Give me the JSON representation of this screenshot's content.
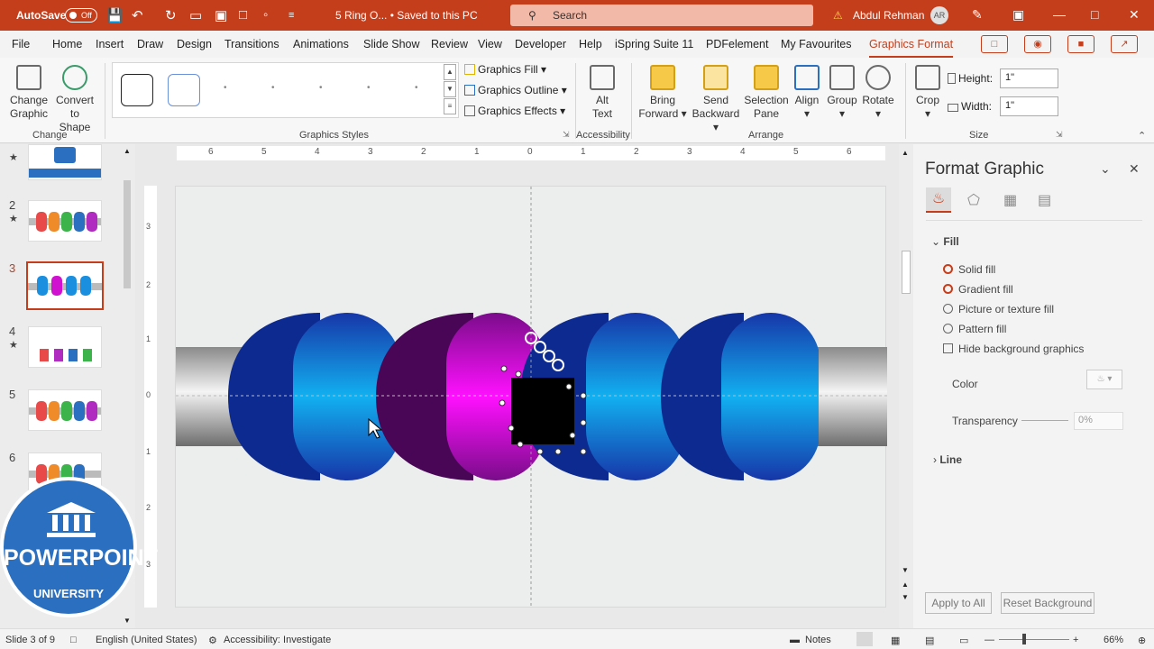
{
  "titlebar": {
    "autosave_label": "AutoSave",
    "autosave_state": "Off",
    "doc_title": "5 Ring O...  •  Saved to this PC",
    "search_placeholder": "Search",
    "user_name": "Abdul Rehman",
    "user_initials": "AR"
  },
  "menu": [
    "File",
    "Home",
    "Insert",
    "Draw",
    "Design",
    "Transitions",
    "Animations",
    "Slide Show",
    "Review",
    "View",
    "Developer",
    "Help",
    "iSpring Suite 11",
    "PDFelement",
    "My Favourites",
    "Graphics Format"
  ],
  "ribbon": {
    "change_graphic": "Change\nGraphic",
    "convert_to_shape": "Convert\nto Shape",
    "group_change": "Change",
    "graphics_fill": "Graphics Fill",
    "graphics_outline": "Graphics Outline",
    "graphics_effects": "Graphics Effects",
    "group_styles": "Graphics Styles",
    "alt_text": "Alt\nText",
    "group_accessibility": "Accessibility",
    "bring_forward": "Bring\nForward",
    "send_backward": "Send\nBackward",
    "selection_pane": "Selection\nPane",
    "align": "Align",
    "group_btn": "Group",
    "rotate": "Rotate",
    "group_arrange": "Arrange",
    "crop": "Crop",
    "height_label": "Height:",
    "height_value": "1\"",
    "width_label": "Width:",
    "width_value": "1\"",
    "group_size": "Size"
  },
  "thumbnails": [
    {
      "number": "",
      "star": "★"
    },
    {
      "number": "2",
      "star": "★"
    },
    {
      "number": "3",
      "star": ""
    },
    {
      "number": "4",
      "star": "★"
    },
    {
      "number": "5",
      "star": ""
    },
    {
      "number": "6",
      "star": ""
    }
  ],
  "logo": {
    "line1": "POWERPOINT",
    "line2": "UNIVERSITY"
  },
  "ruler": {
    "h_ticks": [
      "6",
      "5",
      "4",
      "3",
      "2",
      "1",
      "0",
      "1",
      "2",
      "3",
      "4",
      "5",
      "6"
    ],
    "v_ticks": [
      "3",
      "2",
      "1",
      "0",
      "1",
      "2",
      "3"
    ]
  },
  "panel": {
    "title": "Format Graphic",
    "section_fill": "Fill",
    "solid_fill": "Solid fill",
    "gradient_fill": "Gradient fill",
    "picture_fill": "Picture or texture fill",
    "pattern_fill": "Pattern fill",
    "hide_bg": "Hide background graphics",
    "color_label": "Color",
    "transparency_label": "Transparency",
    "transparency_value": "0%",
    "section_line": "Line",
    "apply_all": "Apply to All",
    "reset_bg": "Reset Background"
  },
  "status": {
    "slide_info": "Slide 3 of 9",
    "language": "English (United States)",
    "accessibility": "Accessibility: Investigate",
    "notes": "Notes",
    "zoom": "66%"
  },
  "colors": {
    "accent": "#c43e1c",
    "ring_blue": "#1a8fe0",
    "ring_magenta": "#d012d0"
  }
}
